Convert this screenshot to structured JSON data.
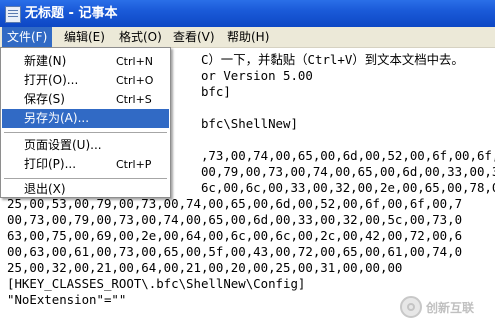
{
  "window": {
    "title": "无标题 - 记事本"
  },
  "menubar": {
    "items": [
      {
        "label": "文件(F)"
      },
      {
        "label": "编辑(E)"
      },
      {
        "label": "格式(O)"
      },
      {
        "label": "查看(V)"
      },
      {
        "label": "帮助(H)"
      }
    ]
  },
  "file_menu": {
    "items": [
      {
        "label": "新建(N)",
        "shortcut": "Ctrl+N"
      },
      {
        "label": "打开(O)...",
        "shortcut": "Ctrl+O"
      },
      {
        "label": "保存(S)",
        "shortcut": "Ctrl+S"
      },
      {
        "label": "另存为(A)...",
        "shortcut": ""
      },
      {
        "label": "页面设置(U)...",
        "shortcut": ""
      },
      {
        "label": "打印(P)...",
        "shortcut": "Ctrl+P"
      },
      {
        "label": "退出(X)",
        "shortcut": ""
      }
    ],
    "highlighted": "另存为(A)..."
  },
  "editor": {
    "lines": [
      "                          C）一下，并黏贴（Ctrl+V）到文本文档中去。",
      "                          or Version 5.00",
      "                          bfc]",
      "",
      "                          bfc\\ShellNew]",
      "",
      "                          ,73,00,74,00,65,00,6d,00,52,00,6f,00,6f,",
      "                          00,79,00,73,00,74,00,65,00,6d,00,33,00,3",
      "                          6c,00,6c,00,33,00,32,00,2e,00,65,00,78,0",
      "25,00,53,00,79,00,73,00,74,00,65,00,6d,00,52,00,6f,00,6f,00,7",
      "00,73,00,79,00,73,00,74,00,65,00,6d,00,33,00,32,00,5c,00,73,0",
      "63,00,75,00,69,00,2e,00,64,00,6c,00,6c,00,2c,00,42,00,72,00,6",
      "00,63,00,61,00,73,00,65,00,5f,00,43,00,72,00,65,00,61,00,74,0",
      "25,00,32,00,21,00,64,00,21,00,20,00,25,00,31,00,00,00",
      "[HKEY_CLASSES_ROOT\\.bfc\\ShellNew\\Config]",
      "\"NoExtension\"=\"\""
    ]
  },
  "watermark": {
    "text": "创新互联"
  }
}
